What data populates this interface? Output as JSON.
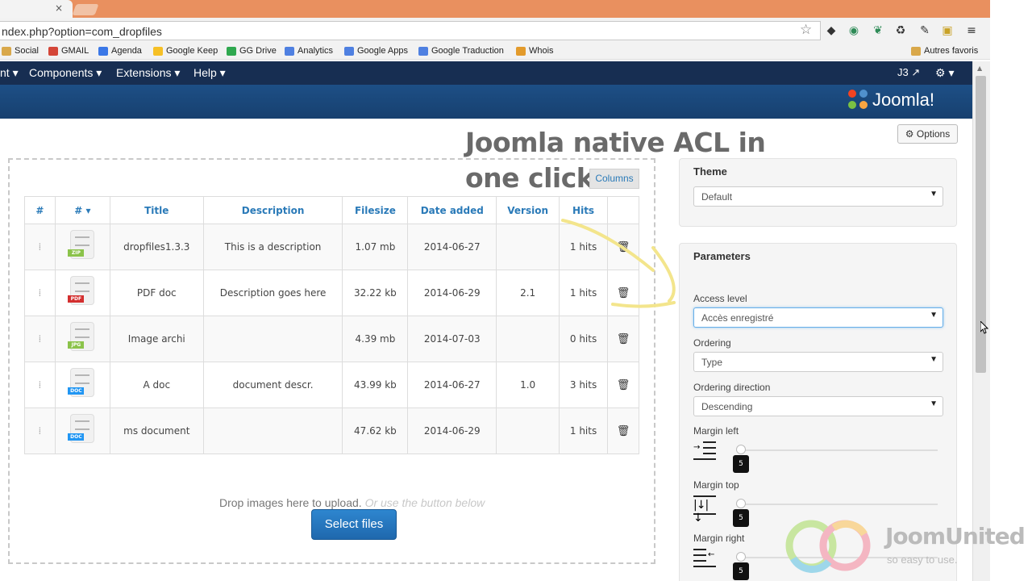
{
  "browser": {
    "tab_close": "×",
    "url": "ndex.php?option=com_dropfiles",
    "bookmarks": [
      {
        "label": "Social",
        "icon": "folder-icon",
        "color": "#d9a84a"
      },
      {
        "label": "GMAIL",
        "icon": "gmail-icon",
        "color": "#d44638"
      },
      {
        "label": "Agenda",
        "icon": "calendar-icon",
        "color": "#3b78e7"
      },
      {
        "label": "Google Keep",
        "icon": "keep-icon",
        "color": "#f6c026"
      },
      {
        "label": "GG Drive",
        "icon": "drive-icon",
        "color": "#2fa84f"
      },
      {
        "label": "Analytics",
        "icon": "google-icon",
        "color": "#4f80e1"
      },
      {
        "label": "Google Apps",
        "icon": "google-icon",
        "color": "#4f80e1"
      },
      {
        "label": "Google Traduction",
        "icon": "translate-icon",
        "color": "#4f80e1"
      },
      {
        "label": "Whois",
        "icon": "whois-icon",
        "color": "#e39b2c"
      }
    ],
    "other_bookmarks": "Autres favoris"
  },
  "nav": {
    "items": [
      "nt ▾",
      "Components ▾",
      "Extensions ▾",
      "Help ▾"
    ],
    "user": "J3",
    "gear": "⚙ ▾"
  },
  "header": {
    "brand": "Joomla!"
  },
  "toolbar": {
    "options_label": "Options"
  },
  "overlay": {
    "line1": "Joomla native ACL in",
    "line2": "one click"
  },
  "files": {
    "columns_label": "Columns",
    "headers": [
      "#",
      "# ▾",
      "Title",
      "Description",
      "Filesize",
      "Date added",
      "Version",
      "Hits"
    ],
    "rows": [
      {
        "type": "ZIP",
        "tag_color": "#8bc34a",
        "title": "dropfiles1.3.3",
        "description": "This is a description",
        "filesize": "1.07 mb",
        "date": "2014-06-27",
        "version": "",
        "hits": "1 hits"
      },
      {
        "type": "PDF",
        "tag_color": "#d32f2f",
        "title": "PDF doc",
        "description": "Description goes here",
        "filesize": "32.22 kb",
        "date": "2014-06-29",
        "version": "2.1",
        "hits": "1 hits"
      },
      {
        "type": "JPG",
        "tag_color": "#8bc34a",
        "title": "Image archi",
        "description": "",
        "filesize": "4.39 mb",
        "date": "2014-07-03",
        "version": "",
        "hits": "0 hits"
      },
      {
        "type": "DOC",
        "tag_color": "#2196f3",
        "title": "A doc",
        "description": "document descr.",
        "filesize": "43.99 kb",
        "date": "2014-06-27",
        "version": "1.0",
        "hits": "3 hits"
      },
      {
        "type": "DOC",
        "tag_color": "#2196f3",
        "title": "ms document",
        "description": "",
        "filesize": "47.62 kb",
        "date": "2014-06-29",
        "version": "",
        "hits": "1 hits"
      }
    ],
    "drop_text": "Drop images here to upload.",
    "drop_hint": "Or use the button below",
    "select_button": "Select files"
  },
  "theme_panel": {
    "title": "Theme",
    "value": "Default"
  },
  "params_panel": {
    "title": "Parameters",
    "access_label": "Access level",
    "access_value": "Accès enregistré",
    "ordering_label": "Ordering",
    "ordering_value": "Type",
    "direction_label": "Ordering direction",
    "direction_value": "Descending",
    "margin_left_label": "Margin left",
    "margin_left_value": "5",
    "margin_top_label": "Margin top",
    "margin_top_value": "5",
    "margin_right_label": "Margin right",
    "margin_right_value": "5"
  },
  "watermark": {
    "brand_a": "Joom",
    "brand_b": "United",
    "tagline": "so easy to use."
  },
  "colors": {
    "navbar": "#172e52",
    "header": "#1d4f86",
    "link": "#2a7ab8",
    "tabstrip": "#e9905f"
  }
}
